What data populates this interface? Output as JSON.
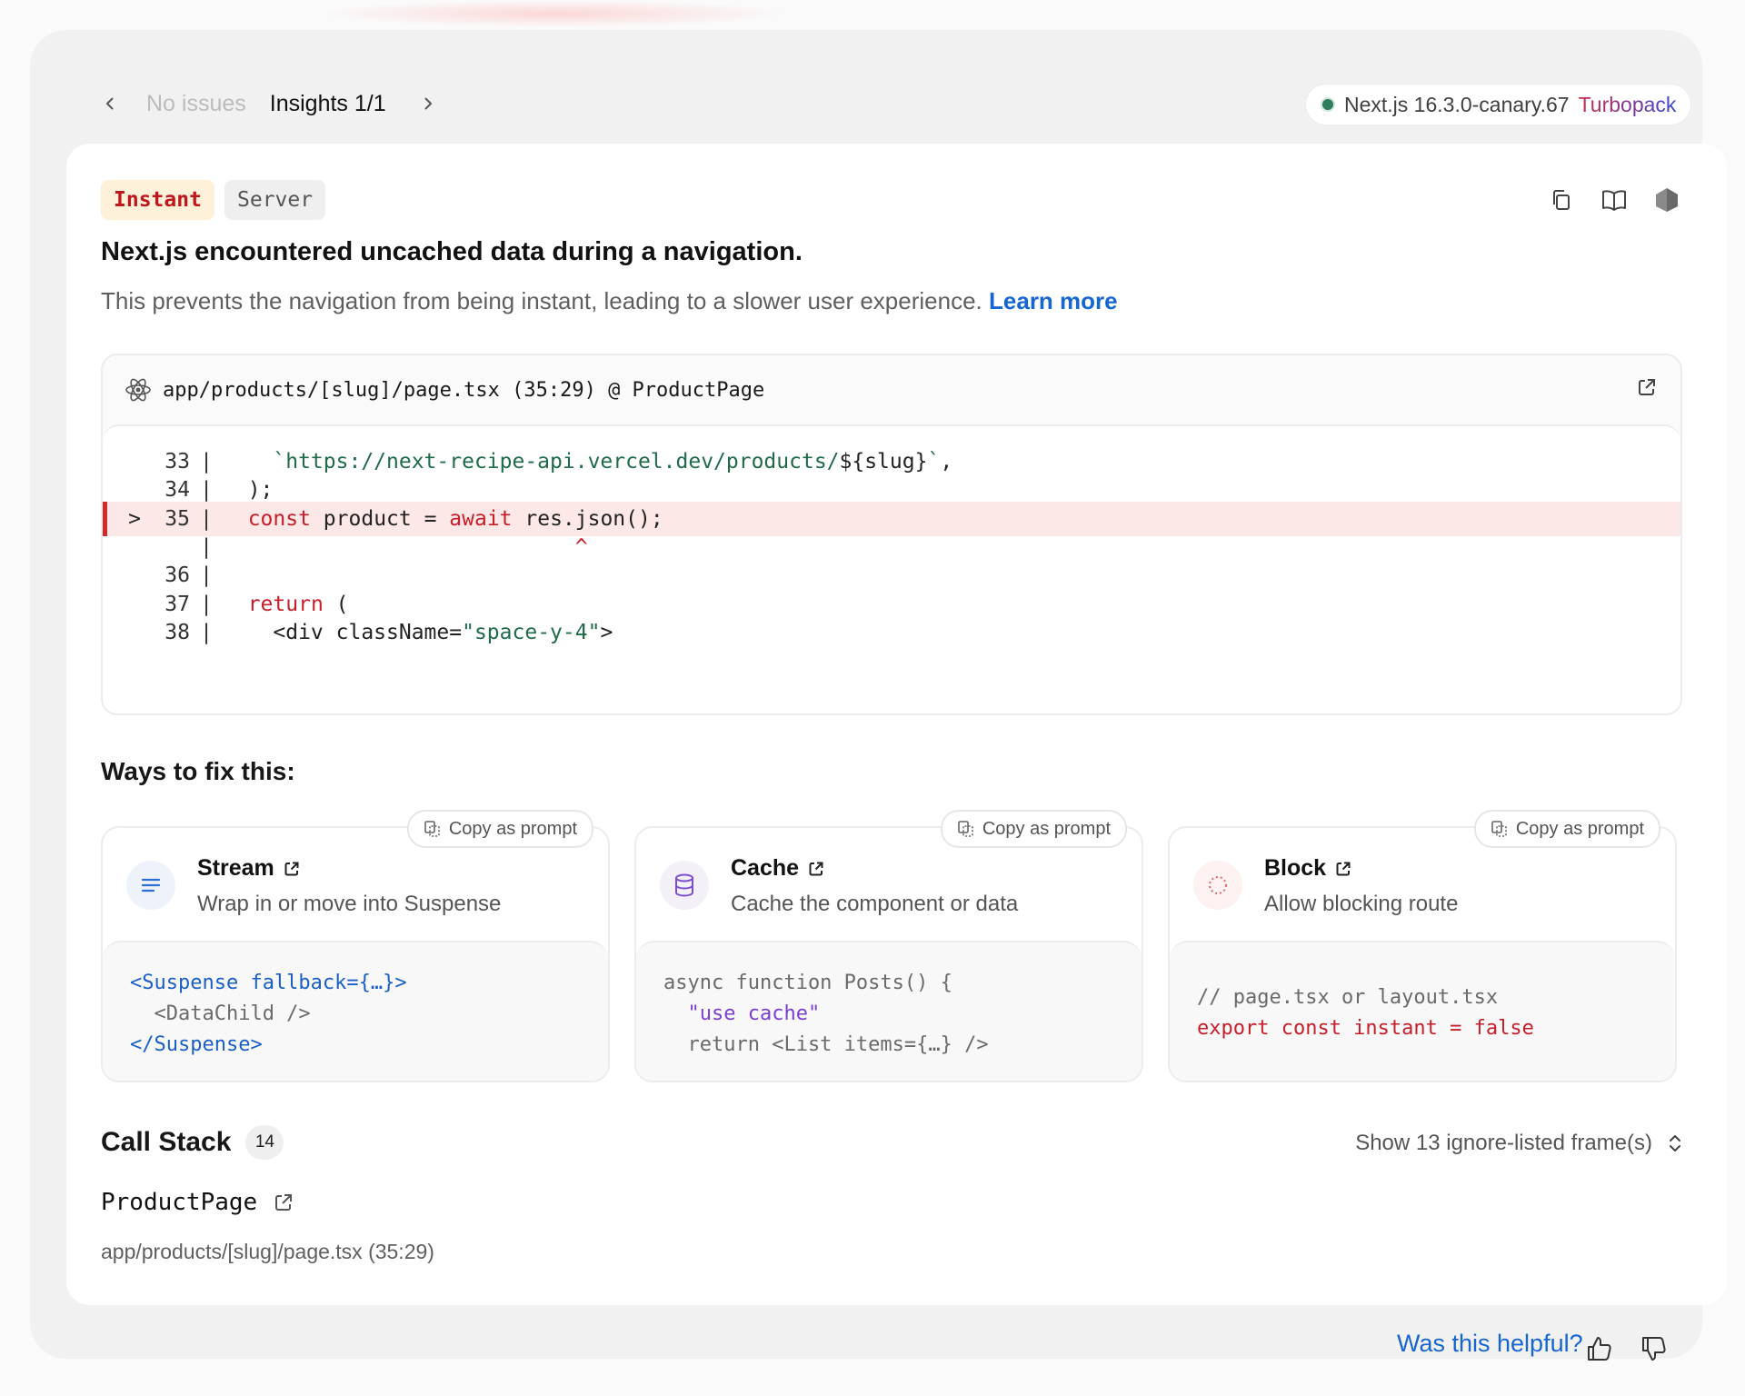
{
  "nav": {
    "no_issues": "No issues",
    "insights": "Insights 1/1"
  },
  "version": {
    "label": "Next.js 16.3.0-canary.67",
    "bundler": "Turbopack",
    "status_color": "#2f7d5d"
  },
  "badges": {
    "instant": "Instant",
    "server": "Server"
  },
  "toolbar_icons": [
    "copy-icon",
    "docs-book-icon",
    "nextjs-hexagon-icon"
  ],
  "error": {
    "title": "Next.js encountered uncached data during a navigation.",
    "description": "This prevents the navigation from being instant, leading to a slower user experience.",
    "learn_more": "Learn more"
  },
  "code_frame": {
    "file": "app/products/[slug]/page.tsx (35:29) @ ProductPage",
    "lines": [
      {
        "marker": "",
        "num": "33",
        "tokens": [
          {
            "t": "    ",
            "c": "plain"
          },
          {
            "t": "`https://next-recipe-api.vercel.dev/products/",
            "c": "green"
          },
          {
            "t": "${slug}",
            "c": "plain"
          },
          {
            "t": "`",
            "c": "green"
          },
          {
            "t": ",",
            "c": "plain"
          }
        ]
      },
      {
        "marker": "",
        "num": "34",
        "tokens": [
          {
            "t": "  );",
            "c": "plain"
          }
        ]
      },
      {
        "marker": ">",
        "num": "35",
        "active": true,
        "tokens": [
          {
            "t": "  ",
            "c": "plain"
          },
          {
            "t": "const",
            "c": "red"
          },
          {
            "t": " product = ",
            "c": "plain"
          },
          {
            "t": "await",
            "c": "red"
          },
          {
            "t": " res.json();",
            "c": "plain"
          }
        ]
      },
      {
        "marker": "",
        "num": "",
        "tokens": [
          {
            "t": "                            ",
            "c": "plain"
          },
          {
            "t": "^",
            "c": "red"
          }
        ]
      },
      {
        "marker": "",
        "num": "36",
        "tokens": []
      },
      {
        "marker": "",
        "num": "37",
        "tokens": [
          {
            "t": "  ",
            "c": "plain"
          },
          {
            "t": "return",
            "c": "red"
          },
          {
            "t": " (",
            "c": "plain"
          }
        ]
      },
      {
        "marker": "",
        "num": "38",
        "tokens": [
          {
            "t": "    <div className=",
            "c": "plain"
          },
          {
            "t": "\"space-y-4\"",
            "c": "green"
          },
          {
            "t": ">",
            "c": "plain"
          }
        ]
      }
    ]
  },
  "ways": {
    "heading": "Ways to fix this:",
    "copy_label": "Copy as prompt",
    "cards": [
      {
        "title": "Stream",
        "desc": "Wrap in or move into Suspense",
        "icon": "lines-icon",
        "icon_color": "#2c6fd6",
        "icon_bg": "#eef3fb",
        "code": [
          [
            {
              "t": "<Suspense fallback={…}>",
              "c": "#1a5fc8"
            }
          ],
          [
            {
              "t": "  <DataChild />",
              "c": "#6a6a6a"
            }
          ],
          [
            {
              "t": "</Suspense>",
              "c": "#1a5fc8"
            }
          ]
        ]
      },
      {
        "title": "Cache",
        "desc": "Cache the component or data",
        "icon": "database-icon",
        "icon_color": "#7a4fd6",
        "icon_bg": "#f3f1f7",
        "code": [
          [
            {
              "t": "async function Posts() {",
              "c": "#6a6a6a"
            }
          ],
          [
            {
              "t": "  \"use cache\"",
              "c": "#7a3fd2"
            }
          ],
          [
            {
              "t": "  return <List items={…} />",
              "c": "#6a6a6a"
            }
          ]
        ]
      },
      {
        "title": "Block",
        "desc": "Allow blocking route",
        "icon": "spinner-icon",
        "icon_color": "#e06a6a",
        "icon_bg": "#fdf1f1",
        "code": [
          [
            {
              "t": "// page.tsx or layout.tsx",
              "c": "#6a6a6a"
            }
          ],
          [
            {
              "t": "export const instant = false",
              "c": "#c81e2b"
            }
          ]
        ]
      }
    ]
  },
  "call_stack": {
    "title": "Call Stack",
    "count": "14",
    "show_frames": "Show 13 ignore-listed frame(s)",
    "frame_name": "ProductPage",
    "frame_path": "app/products/[slug]/page.tsx (35:29)"
  },
  "feedback": {
    "question": "Was this helpful?"
  }
}
